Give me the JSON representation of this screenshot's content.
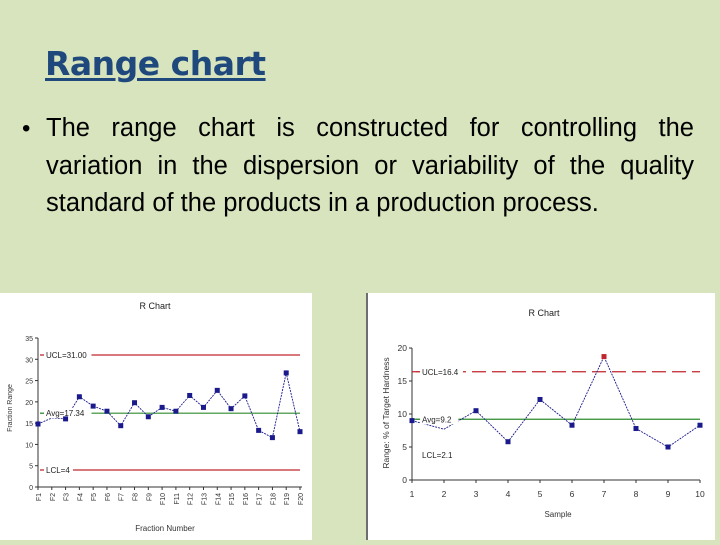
{
  "slide": {
    "title": "Range chart",
    "bullet": "•",
    "body": "The range chart is constructed for controlling the variation in the dispersion or variability of the quality standard of the products in a production process.",
    "background_color": "#d7e4bd",
    "title_color": "#1f497d"
  },
  "chart_data": [
    {
      "type": "line",
      "title": "R Chart",
      "xlabel": "Fraction Number",
      "ylabel": "Fraction Range",
      "categories": [
        "F1",
        "F2",
        "F3",
        "F4",
        "F5",
        "F6",
        "F7",
        "F8",
        "F9",
        "F10",
        "F11",
        "F12",
        "F13",
        "F14",
        "F15",
        "F16",
        "F17",
        "F18",
        "F19",
        "F20"
      ],
      "values": [
        14.8,
        16.2,
        16.0,
        21.2,
        19.0,
        17.8,
        14.4,
        19.8,
        16.5,
        18.7,
        17.8,
        21.5,
        18.7,
        22.7,
        18.4,
        21.4,
        13.3,
        11.6,
        26.8,
        13.0
      ],
      "hidden_markers": [
        "F2"
      ],
      "ylim": [
        0,
        35
      ],
      "yticks": [
        0,
        5,
        10,
        15,
        20,
        25,
        30,
        35
      ],
      "ytick_labels": [
        "0",
        "5",
        "10",
        "15",
        "20",
        "25",
        "30",
        "35"
      ],
      "control_lines": [
        {
          "name": "UCL",
          "label": "UCL=31.00",
          "value": 31.0,
          "color": "#c0262d",
          "style": "solid"
        },
        {
          "name": "Avg",
          "label": "Avg=17.34",
          "value": 17.34,
          "color": "#2e8b2e",
          "style": "solid"
        },
        {
          "name": "LCL",
          "label": "LCL=4",
          "value": 4.0,
          "color": "#c0262d",
          "style": "solid"
        }
      ],
      "series_color": "#1a1a8c",
      "grid": false
    },
    {
      "type": "line",
      "title": "R Chart",
      "xlabel": "Sample",
      "ylabel": "Range: % of Target Hardness",
      "categories": [
        "1",
        "2",
        "3",
        "4",
        "5",
        "6",
        "7",
        "8",
        "9",
        "10"
      ],
      "values": [
        9.0,
        7.7,
        10.5,
        5.8,
        12.2,
        8.3,
        18.7,
        7.8,
        5.0,
        8.3
      ],
      "hidden_markers": [
        "2"
      ],
      "highlight_points": [
        {
          "category": "7",
          "color": "#c0262d"
        }
      ],
      "ylim": [
        0,
        20
      ],
      "yticks": [
        0,
        5,
        10,
        15,
        20
      ],
      "ytick_labels": [
        "0",
        "5",
        "10",
        "15",
        "20"
      ],
      "control_lines": [
        {
          "name": "UCL",
          "label": "UCL=16.4",
          "value": 16.4,
          "color": "#c0262d",
          "style": "dashed"
        },
        {
          "name": "Avg",
          "label": "Avg=9.2",
          "value": 9.2,
          "color": "#2e8b2e",
          "style": "solid"
        },
        {
          "name": "LCL",
          "label": "LCL=2.1",
          "value": 2.1,
          "color": "none",
          "style": "none"
        }
      ],
      "series_color": "#1a1a8c",
      "grid": false
    }
  ]
}
